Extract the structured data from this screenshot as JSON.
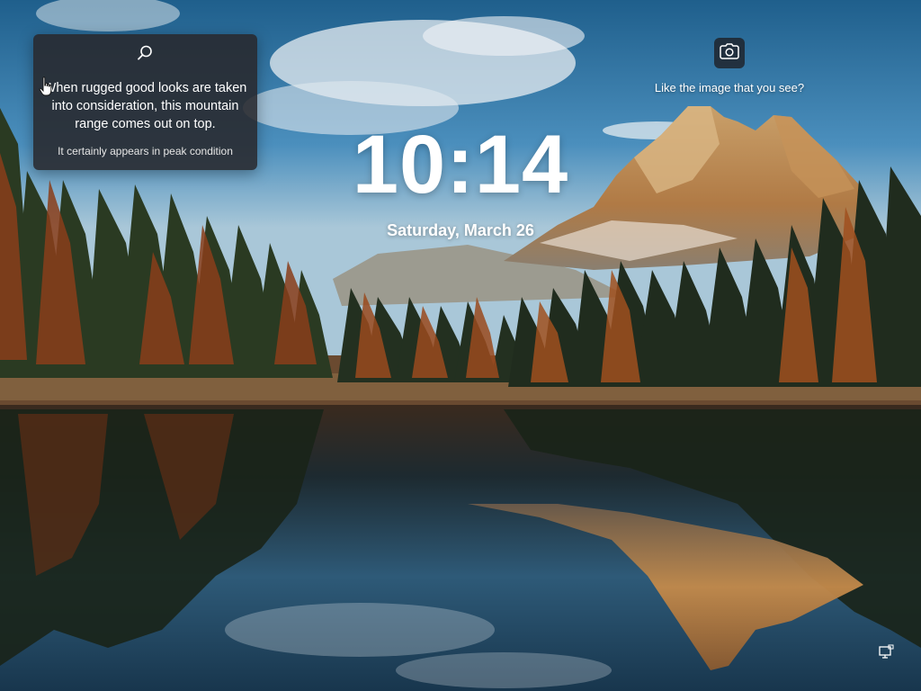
{
  "lockscreen": {
    "time": "10:14",
    "date": "Saturday, March 26"
  },
  "spotlight": {
    "headline": "When rugged good looks are taken into consideration, this mountain range comes out on top.",
    "subline": "It certainly appears in peak condition",
    "search_icon": "search-icon"
  },
  "feedback": {
    "prompt": "Like the image that you see?",
    "icon": "camera-icon"
  },
  "status": {
    "network_icon": "network-icon"
  },
  "colors": {
    "card_bg": "#28282c",
    "text": "#ffffff",
    "sky": "#2a6f9e",
    "water": "#1a3b52"
  }
}
